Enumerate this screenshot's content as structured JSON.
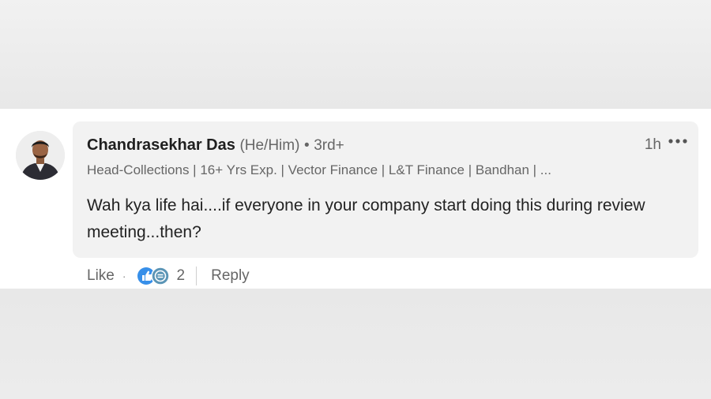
{
  "comment": {
    "author_name": "Chandrasekhar Das",
    "pronouns": "(He/Him)",
    "separator": "•",
    "connection_degree": "3rd+",
    "headline": "Head-Collections | 16+ Yrs Exp. | Vector Finance | L&T Finance | Bandhan | ...",
    "time_ago": "1h",
    "more_options_icon": "ellipsis-icon",
    "text": "Wah kya life hai....if everyone in your company start doing this during review meeting...then?"
  },
  "actions": {
    "like_label": "Like",
    "dot": "·",
    "reaction_icons": [
      "like-reaction-icon",
      "support-reaction-icon"
    ],
    "reaction_count": "2",
    "reply_label": "Reply"
  },
  "colors": {
    "bubble_background": "#f2f2f2",
    "like_reaction": "#378fe9",
    "support_reaction": "#5b95b6",
    "muted_text": "#666666"
  }
}
